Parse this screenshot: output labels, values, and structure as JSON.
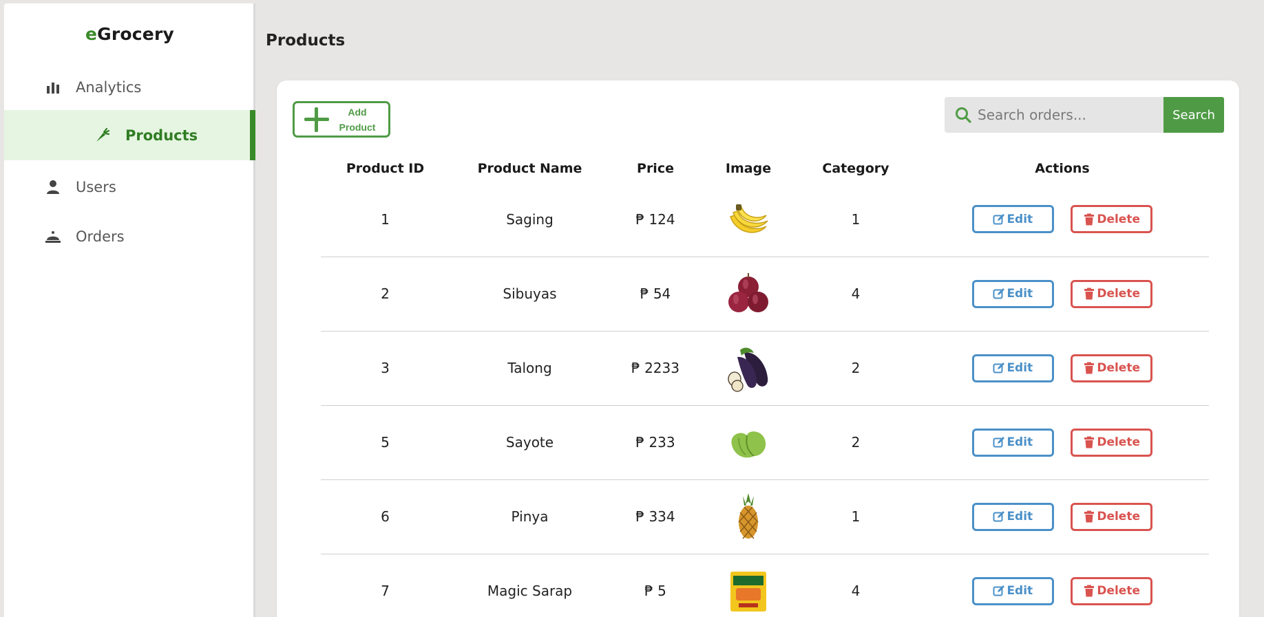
{
  "brand": {
    "prefix": "e",
    "name": "Grocery"
  },
  "sidebar": {
    "items": [
      {
        "label": "Analytics",
        "icon": "bar-chart-icon"
      },
      {
        "label": "Products",
        "icon": "carrot-icon",
        "active": true
      },
      {
        "label": "Users",
        "icon": "user-icon"
      },
      {
        "label": "Orders",
        "icon": "service-bell-icon"
      }
    ]
  },
  "page": {
    "title": "Products"
  },
  "toolbar": {
    "add_line1": "Add",
    "add_line2": "Product",
    "search_placeholder": "Search orders...",
    "search_label": "Search"
  },
  "table": {
    "headers": [
      "Product ID",
      "Product Name",
      "Price",
      "Image",
      "Category",
      "Actions"
    ],
    "edit_label": "Edit",
    "delete_label": "Delete",
    "rows": [
      {
        "id": "1",
        "name": "Saging",
        "price": "₱ 124",
        "image": "banana",
        "category": "1"
      },
      {
        "id": "2",
        "name": "Sibuyas",
        "price": "₱ 54",
        "image": "red-onion",
        "category": "4"
      },
      {
        "id": "3",
        "name": "Talong",
        "price": "₱ 2233",
        "image": "eggplant",
        "category": "2"
      },
      {
        "id": "5",
        "name": "Sayote",
        "price": "₱ 233",
        "image": "chayote",
        "category": "2"
      },
      {
        "id": "6",
        "name": "Pinya",
        "price": "₱ 334",
        "image": "pineapple",
        "category": "1"
      },
      {
        "id": "7",
        "name": "Magic Sarap",
        "price": "₱ 5",
        "image": "seasoning-pack",
        "category": "4"
      }
    ]
  },
  "colors": {
    "brand_green": "#4f9b45",
    "active_bg": "#e6f5e2",
    "edit_blue": "#4a90c8",
    "delete_red": "#d9534f"
  }
}
